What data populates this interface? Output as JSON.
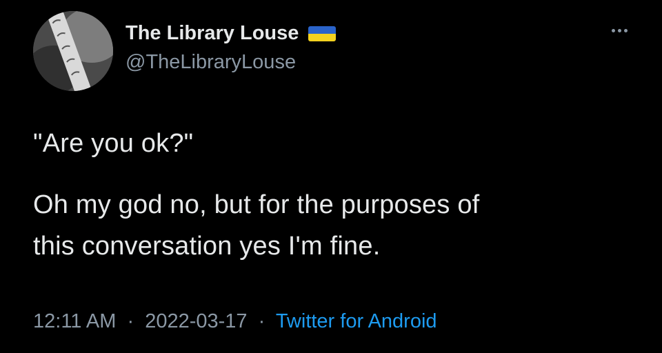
{
  "user": {
    "display_name": "The Library Louse",
    "handle": "@TheLibraryLouse",
    "flag_icon": "ukraine-flag-icon"
  },
  "tweet": {
    "line1": "\"Are you ok?\"",
    "line2": "Oh my god no, but for the purposes of",
    "line3": "this conversation yes I'm fine."
  },
  "meta": {
    "time": "12:11 AM",
    "date": "2022-03-17",
    "separator": "·",
    "source": "Twitter for Android"
  },
  "colors": {
    "background": "#000000",
    "text": "#e7e9ea",
    "secondary": "#8b98a5",
    "link": "#1d9bf0",
    "flag_blue": "#2a63c9",
    "flag_yellow": "#f4d21f"
  }
}
